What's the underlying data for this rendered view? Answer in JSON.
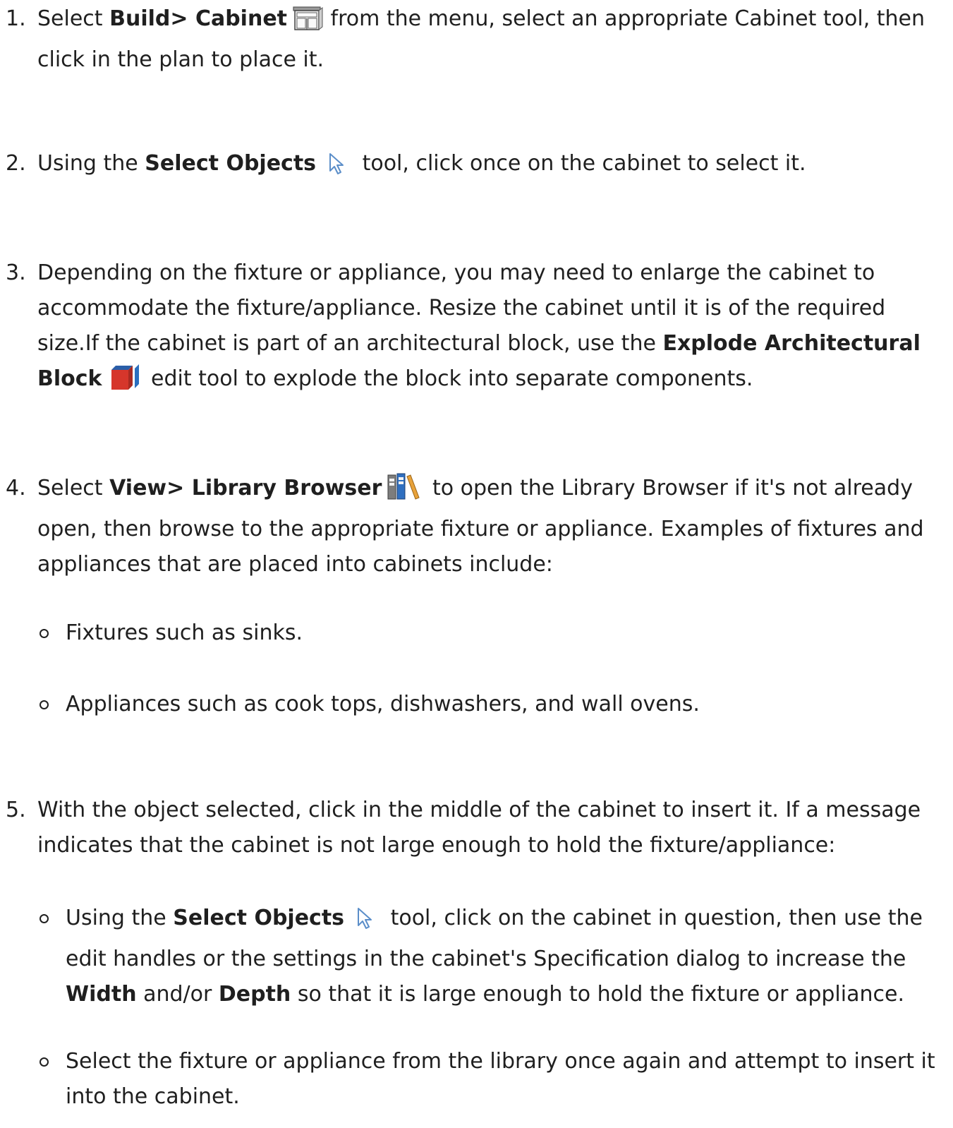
{
  "steps": [
    {
      "number": "1.",
      "pre": "Select ",
      "bold": "Build> Cabinet",
      "icon": "cabinet-icon",
      "post": " from the menu, select an appropriate Cabinet tool, then click in the plan to place it."
    },
    {
      "number": "2.",
      "pre": "Using the ",
      "bold": "Select Objects",
      "icon": "select-arrow-icon",
      "post": " tool, click once on the cabinet to select it."
    },
    {
      "number": "3.",
      "pre": "Depending on the fixture or appliance, you may need to enlarge the cabinet to accommodate the fixture/appliance. Resize the cabinet until it is of the required size.If the cabinet is part of an architectural block, use the ",
      "bold": "Explode Architectural Block",
      "icon": "explode-block-icon",
      "post": " edit tool to explode the block into separate components."
    },
    {
      "number": "4.",
      "pre": "Select ",
      "bold": "View> Library Browser",
      "icon": "library-browser-icon",
      "post": " to open the Library Browser if it's not already open, then browse to the appropriate fixture or appliance. Examples of fixtures and appliances that are placed into cabinets include:",
      "bullets": [
        "Fixtures such as sinks.",
        "Appliances such as cook tops, dishwashers, and wall ovens."
      ]
    },
    {
      "number": "5.",
      "text": "With the object selected, click in the middle of the cabinet to insert it. If a message indicates that the cabinet is not large enough to hold the fixture/appliance:",
      "bullet1": {
        "pre": "Using the ",
        "bold": "Select Objects",
        "icon": "select-arrow-icon",
        "mid": " tool, click on the cabinet in question, then use the edit handles or the settings in the cabinet's Specification dialog to increase the ",
        "bold2": "Width",
        "mid2": " and/or ",
        "bold3": "Depth",
        "post": " so that it is large enough to hold the fixture or appliance."
      },
      "bullet2": "Select the fixture or appliance from the library once again and attempt to insert it into the cabinet."
    }
  ]
}
